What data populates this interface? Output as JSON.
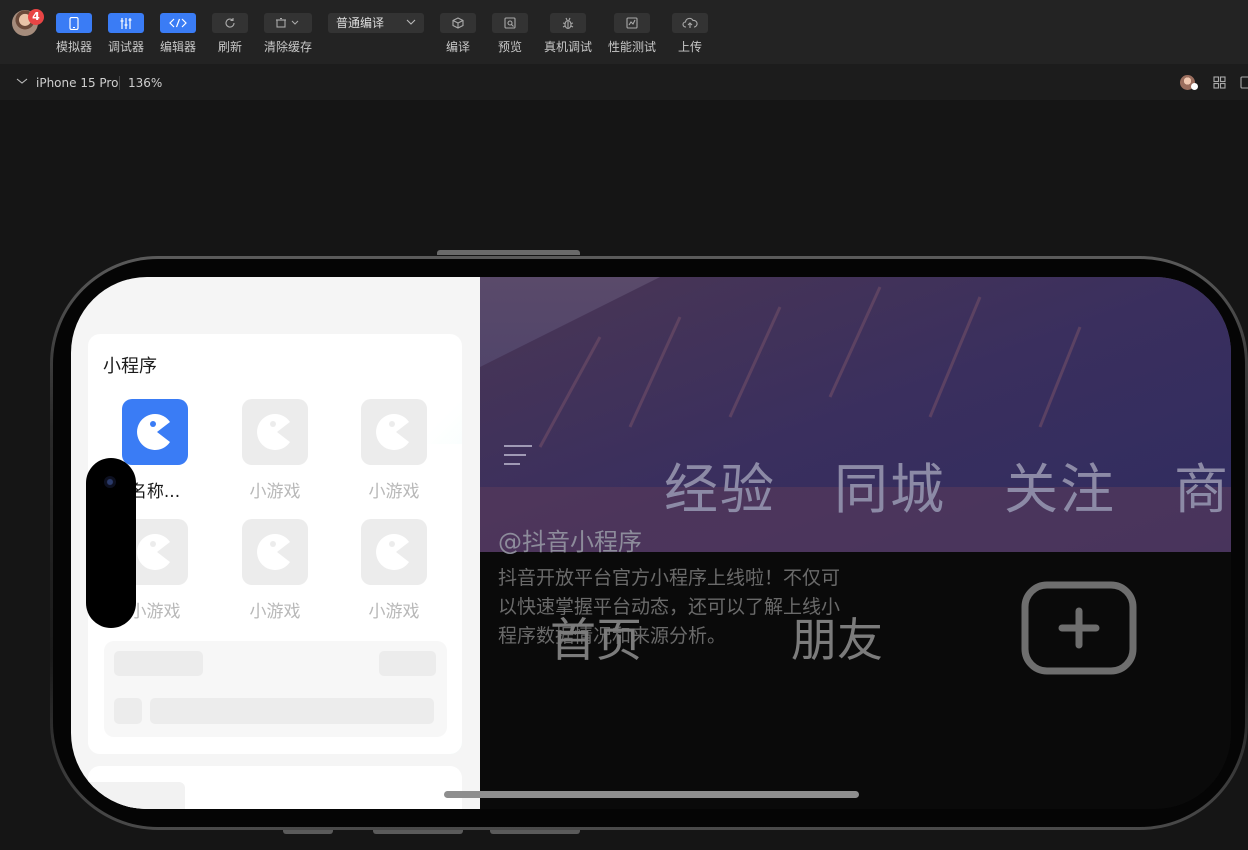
{
  "toolbar": {
    "badge_count": "4",
    "simulator": "模拟器",
    "debugger": "调试器",
    "editor": "编辑器",
    "refresh": "刷新",
    "clear_cache": "清除缓存",
    "compile_mode": "普通编译",
    "compile": "编译",
    "preview": "预览",
    "device_debug": "真机调试",
    "perf_test": "性能测试",
    "upload": "上传",
    "accent_color": "#3a7cf5"
  },
  "subbar": {
    "device": "iPhone 15 Pro",
    "zoom": "136%"
  },
  "mini_program": {
    "title": "小程序",
    "apps": [
      {
        "name": "名称..."
      },
      {
        "name": "小游戏"
      },
      {
        "name": "小游戏"
      },
      {
        "name": "小游戏"
      },
      {
        "name": "小游戏"
      },
      {
        "name": "小游戏"
      }
    ]
  },
  "video": {
    "tabs": [
      "经验",
      "同城",
      "关注",
      "商"
    ],
    "handle": "@抖音小程序",
    "description": "抖音开放平台官方小程序上线啦！不仅可以快速掌握平台动态，还可以了解上线小程序数据情况和来源分析。",
    "bottom_tabs": [
      "首页",
      "朋友"
    ]
  }
}
